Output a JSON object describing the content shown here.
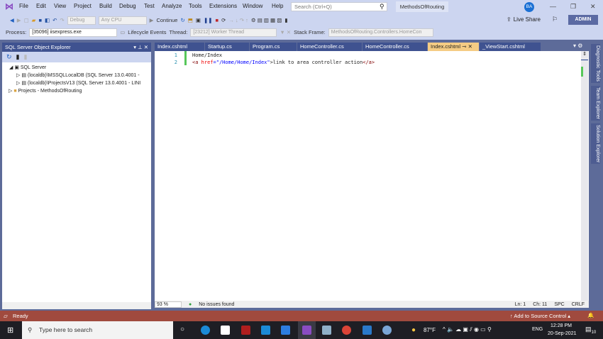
{
  "menu": [
    "File",
    "Edit",
    "View",
    "Project",
    "Build",
    "Debug",
    "Test",
    "Analyze",
    "Tools",
    "Extensions",
    "Window",
    "Help"
  ],
  "search_placeholder": "Search (Ctrl+Q)",
  "project_name": "MethodsOfRouting",
  "avatar": "BA",
  "toolbar": {
    "config": "Debug",
    "platform": "Any CPU",
    "continue": "Continue",
    "live_share": "Live Share",
    "admin": "ADMIN"
  },
  "debug_bar": {
    "process_label": "Process:",
    "process": "[35096] iisexpress.exe",
    "lifecycle": "Lifecycle Events",
    "thread_label": "Thread:",
    "thread": "[23212] Worker Thread",
    "stack_label": "Stack Frame:",
    "stack": "MethodsOfRouting.Controllers.HomeCon"
  },
  "explorer": {
    "title": "SQL Server Object Explorer",
    "items": [
      "SQL Server",
      "(localdb)\\MSSQLLocalDB (SQL Server 13.0.4001 - ",
      "(localdb)\\ProjectsV13 (SQL Server 13.0.4001 - LINI",
      "Projects - MethodsOfRouting"
    ]
  },
  "tabs": [
    "Index.cshtml",
    "Startup.cs",
    "Program.cs",
    "HomeController.cs",
    "HomeController.cs",
    "Index.cshtml",
    "_ViewStart.cshtml"
  ],
  "code": {
    "line1": "Home/Index",
    "l2_open": "<a ",
    "l2_attr": "href",
    "l2_eq": "=",
    "l2_val": "\"/Home/Home/Index\"",
    "l2_text": ">link to area controller action",
    "l2_close": "</a>"
  },
  "side_tabs": [
    "Diagnostic Tools",
    "Team Explorer",
    "Solution Explorer"
  ],
  "editor_status": {
    "zoom": "93 %",
    "issues": "No issues found",
    "ln": "Ln: 1",
    "ch": "Ch: 11",
    "spc": "SPC",
    "crlf": "CRLF"
  },
  "status": {
    "ready": "Ready",
    "source_control": "Add to Source Control"
  },
  "taskbar": {
    "search": "Type here to search",
    "temp": "87°F",
    "lang": "ENG",
    "time": "12:28 PM",
    "date": "20-Sep-2021",
    "notifications": "10"
  }
}
